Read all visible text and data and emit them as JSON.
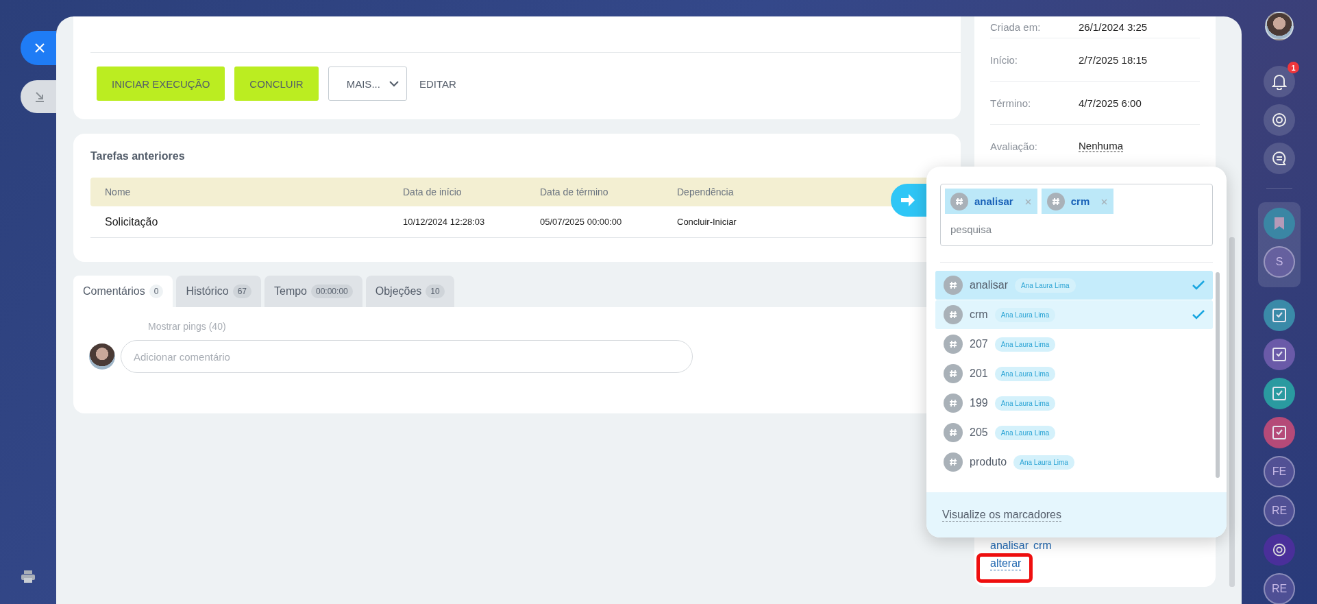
{
  "top_actions": [
    {
      "label": "INICIAR EXECUÇÃO",
      "kind": "primary"
    },
    {
      "label": "CONCLUIR",
      "kind": "primary"
    },
    {
      "label": "MAIS...",
      "kind": "dropdown"
    },
    {
      "label": "EDITAR",
      "kind": "link"
    }
  ],
  "previous_tasks": {
    "title": "Tarefas anteriores",
    "columns": [
      "Nome",
      "Data de início",
      "Data de término",
      "Dependência"
    ],
    "rows": [
      {
        "cells": [
          "Solicitação",
          "10/12/2024 12:28:03",
          "05/07/2025 00:00:00",
          "Concluir-Iniciar"
        ]
      }
    ]
  },
  "tabs": [
    {
      "label": "Comentários",
      "count": "0",
      "selected": true
    },
    {
      "label": "Histórico",
      "count": "67",
      "selected": false
    },
    {
      "label": "Tempo",
      "count": "00:00:00",
      "selected": false
    },
    {
      "label": "Objeções",
      "count": "10",
      "selected": false
    }
  ],
  "comments": {
    "show_pings": "Mostrar pings (40)",
    "placeholder": "Adicionar comentário"
  },
  "details": [
    {
      "label": "Criada em:",
      "value": "26/1/2024 3:25",
      "kind": "text"
    },
    {
      "label": "Início:",
      "value": "2/7/2025 18:15",
      "kind": "text"
    },
    {
      "label": "Término:",
      "value": "4/7/2025 6:00",
      "kind": "text"
    },
    {
      "label": "Avaliação:",
      "value": "Nenhuma",
      "kind": "link"
    }
  ],
  "tags": {
    "current": [
      "analisar",
      "crm"
    ],
    "change": "alterar"
  },
  "tag_picker": {
    "chips": [
      "analisar",
      "crm"
    ],
    "placeholder": "pesquisa",
    "items": [
      {
        "name": "analisar",
        "owner": "Ana Laura Lima",
        "selected": true
      },
      {
        "name": "crm",
        "owner": "Ana Laura Lima",
        "selected": true
      },
      {
        "name": "207",
        "owner": "Ana Laura Lima",
        "selected": false
      },
      {
        "name": "201",
        "owner": "Ana Laura Lima",
        "selected": false
      },
      {
        "name": "199",
        "owner": "Ana Laura Lima",
        "selected": false
      },
      {
        "name": "205",
        "owner": "Ana Laura Lima",
        "selected": false
      },
      {
        "name": "produto",
        "owner": "Ana Laura Lima",
        "selected": false
      }
    ],
    "footer": "Visualize os marcadores"
  },
  "rail": {
    "badge": "1",
    "group_initial": "S",
    "tasks": [
      {
        "color": "#3a8aa8"
      },
      {
        "color": "#6a5aa8"
      },
      {
        "color": "#2a9aa0"
      },
      {
        "color": "#b54a78"
      }
    ],
    "contacts": [
      {
        "kind": "initials",
        "text": "FE"
      },
      {
        "kind": "initials",
        "text": "RE"
      },
      {
        "kind": "ai"
      },
      {
        "kind": "initials",
        "text": "RE"
      }
    ]
  }
}
